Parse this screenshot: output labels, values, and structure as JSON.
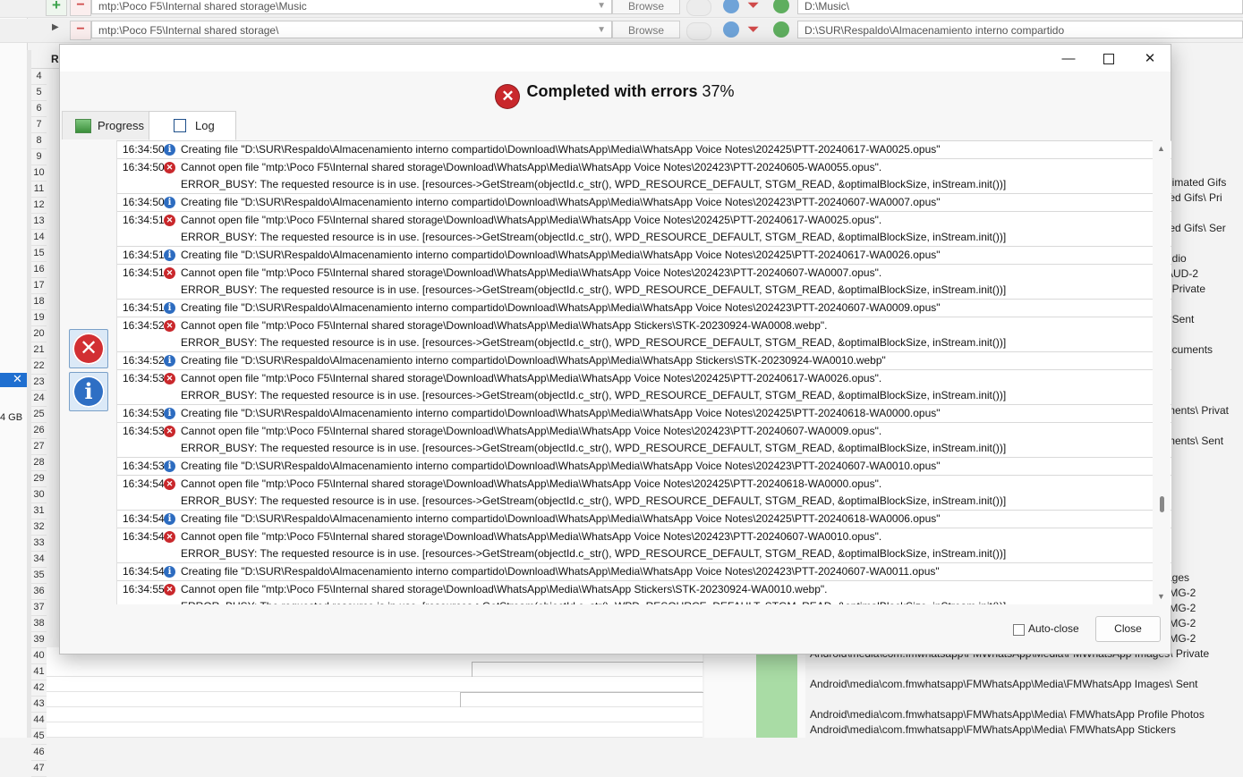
{
  "background": {
    "row1": {
      "path": "mtp:\\Poco F5\\Internal shared storage\\Music",
      "browse": "Browse",
      "dest": "D:\\Music\\"
    },
    "row2": {
      "path": "mtp:\\Poco F5\\Internal shared storage\\",
      "browse": "Browse",
      "dest": "D:\\SUR\\Respaldo\\Almacenamiento interno compartido"
    },
    "column_header": "R",
    "left_size": "4 GB",
    "row_numbers": [
      "4",
      "5",
      "6",
      "7",
      "8",
      "9",
      "10",
      "11",
      "12",
      "13",
      "14",
      "15",
      "16",
      "17",
      "18",
      "19",
      "20",
      "21",
      "22",
      "23",
      "24",
      "25",
      "26",
      "27",
      "28",
      "29",
      "30",
      "31",
      "32",
      "33",
      "34",
      "35",
      "36",
      "37",
      "38",
      "39",
      "40",
      "41",
      "42",
      "43",
      "44",
      "45",
      "46",
      "47"
    ],
    "right_items": [
      {
        "row": 11,
        "text": "nimated Gifs"
      },
      {
        "row": 12,
        "text": "ted Gifs\\ Pri"
      },
      {
        "row": 14,
        "text": "ted Gifs\\ Ser"
      },
      {
        "row": 16,
        "text": "udio"
      },
      {
        "row": 17,
        "text": "AUD-2"
      },
      {
        "row": 18,
        "text": "\\ Private"
      },
      {
        "row": 20,
        "text": "\\ Sent"
      },
      {
        "row": 22,
        "text": "ocuments"
      },
      {
        "row": 26,
        "text": "ments\\ Privat"
      },
      {
        "row": 28,
        "text": "ments\\ Sent"
      },
      {
        "row": 37,
        "text": "ages"
      },
      {
        "row": 38,
        "text": "IMG-2"
      },
      {
        "row": 39,
        "text": "IMG-2"
      },
      {
        "row": 40,
        "text": "IMG-2"
      },
      {
        "row": 41,
        "text": "IMG-2"
      }
    ],
    "bottom_paths": [
      {
        "row": 42,
        "text": "Android\\media\\com.fmwhatsapp\\FMWhatsApp\\Media\\FMWhatsApp Images\\ Private"
      },
      {
        "row": 44,
        "text": "Android\\media\\com.fmwhatsapp\\FMWhatsApp\\Media\\FMWhatsApp Images\\ Sent"
      },
      {
        "row": 46,
        "text": "Android\\media\\com.fmwhatsapp\\FMWhatsApp\\Media\\ FMWhatsApp Profile Photos"
      },
      {
        "row": 47,
        "text": "Android\\media\\com.fmwhatsapp\\FMWhatsApp\\Media\\ FMWhatsApp Stickers"
      }
    ]
  },
  "dialog": {
    "status": "Completed with errors",
    "percent": "37%",
    "tabs": {
      "progress": "Progress",
      "log": "Log"
    },
    "auto_close": "Auto-close",
    "close": "Close",
    "log": [
      {
        "type": "info",
        "time": "16:34:50",
        "msg": "Creating file \"D:\\SUR\\Respaldo\\Almacenamiento interno compartido\\Download\\WhatsApp\\Media\\WhatsApp Voice Notes\\202425\\PTT-20240617-WA0025.opus\""
      },
      {
        "type": "error",
        "time": "16:34:50",
        "msg": "Cannot open file \"mtp:\\Poco F5\\Internal shared storage\\Download\\WhatsApp\\Media\\WhatsApp Voice Notes\\202423\\PTT-20240605-WA0055.opus\".",
        "detail": "ERROR_BUSY: The requested resource is in use. [resources->GetStream(objectId.c_str(), WPD_RESOURCE_DEFAULT, STGM_READ, &optimalBlockSize, inStream.init())]"
      },
      {
        "type": "info",
        "time": "16:34:50",
        "msg": "Creating file \"D:\\SUR\\Respaldo\\Almacenamiento interno compartido\\Download\\WhatsApp\\Media\\WhatsApp Voice Notes\\202423\\PTT-20240607-WA0007.opus\""
      },
      {
        "type": "error",
        "time": "16:34:51",
        "msg": "Cannot open file \"mtp:\\Poco F5\\Internal shared storage\\Download\\WhatsApp\\Media\\WhatsApp Voice Notes\\202425\\PTT-20240617-WA0025.opus\".",
        "detail": "ERROR_BUSY: The requested resource is in use. [resources->GetStream(objectId.c_str(), WPD_RESOURCE_DEFAULT, STGM_READ, &optimalBlockSize, inStream.init())]"
      },
      {
        "type": "info",
        "time": "16:34:51",
        "msg": "Creating file \"D:\\SUR\\Respaldo\\Almacenamiento interno compartido\\Download\\WhatsApp\\Media\\WhatsApp Voice Notes\\202425\\PTT-20240617-WA0026.opus\""
      },
      {
        "type": "error",
        "time": "16:34:51",
        "msg": "Cannot open file \"mtp:\\Poco F5\\Internal shared storage\\Download\\WhatsApp\\Media\\WhatsApp Voice Notes\\202423\\PTT-20240607-WA0007.opus\".",
        "detail": "ERROR_BUSY: The requested resource is in use. [resources->GetStream(objectId.c_str(), WPD_RESOURCE_DEFAULT, STGM_READ, &optimalBlockSize, inStream.init())]"
      },
      {
        "type": "info",
        "time": "16:34:51",
        "msg": "Creating file \"D:\\SUR\\Respaldo\\Almacenamiento interno compartido\\Download\\WhatsApp\\Media\\WhatsApp Voice Notes\\202423\\PTT-20240607-WA0009.opus\""
      },
      {
        "type": "error",
        "time": "16:34:52",
        "msg": "Cannot open file \"mtp:\\Poco F5\\Internal shared storage\\Download\\WhatsApp\\Media\\WhatsApp Stickers\\STK-20230924-WA0008.webp\".",
        "detail": "ERROR_BUSY: The requested resource is in use. [resources->GetStream(objectId.c_str(), WPD_RESOURCE_DEFAULT, STGM_READ, &optimalBlockSize, inStream.init())]"
      },
      {
        "type": "info",
        "time": "16:34:52",
        "msg": "Creating file \"D:\\SUR\\Respaldo\\Almacenamiento interno compartido\\Download\\WhatsApp\\Media\\WhatsApp Stickers\\STK-20230924-WA0010.webp\""
      },
      {
        "type": "error",
        "time": "16:34:53",
        "msg": "Cannot open file \"mtp:\\Poco F5\\Internal shared storage\\Download\\WhatsApp\\Media\\WhatsApp Voice Notes\\202425\\PTT-20240617-WA0026.opus\".",
        "detail": "ERROR_BUSY: The requested resource is in use. [resources->GetStream(objectId.c_str(), WPD_RESOURCE_DEFAULT, STGM_READ, &optimalBlockSize, inStream.init())]"
      },
      {
        "type": "info",
        "time": "16:34:53",
        "msg": "Creating file \"D:\\SUR\\Respaldo\\Almacenamiento interno compartido\\Download\\WhatsApp\\Media\\WhatsApp Voice Notes\\202425\\PTT-20240618-WA0000.opus\""
      },
      {
        "type": "error",
        "time": "16:34:53",
        "msg": "Cannot open file \"mtp:\\Poco F5\\Internal shared storage\\Download\\WhatsApp\\Media\\WhatsApp Voice Notes\\202423\\PTT-20240607-WA0009.opus\".",
        "detail": "ERROR_BUSY: The requested resource is in use. [resources->GetStream(objectId.c_str(), WPD_RESOURCE_DEFAULT, STGM_READ, &optimalBlockSize, inStream.init())]"
      },
      {
        "type": "info",
        "time": "16:34:53",
        "msg": "Creating file \"D:\\SUR\\Respaldo\\Almacenamiento interno compartido\\Download\\WhatsApp\\Media\\WhatsApp Voice Notes\\202423\\PTT-20240607-WA0010.opus\""
      },
      {
        "type": "error",
        "time": "16:34:54",
        "msg": "Cannot open file \"mtp:\\Poco F5\\Internal shared storage\\Download\\WhatsApp\\Media\\WhatsApp Voice Notes\\202425\\PTT-20240618-WA0000.opus\".",
        "detail": "ERROR_BUSY: The requested resource is in use. [resources->GetStream(objectId.c_str(), WPD_RESOURCE_DEFAULT, STGM_READ, &optimalBlockSize, inStream.init())]"
      },
      {
        "type": "info",
        "time": "16:34:54",
        "msg": "Creating file \"D:\\SUR\\Respaldo\\Almacenamiento interno compartido\\Download\\WhatsApp\\Media\\WhatsApp Voice Notes\\202425\\PTT-20240618-WA0006.opus\""
      },
      {
        "type": "error",
        "time": "16:34:54",
        "msg": "Cannot open file \"mtp:\\Poco F5\\Internal shared storage\\Download\\WhatsApp\\Media\\WhatsApp Voice Notes\\202423\\PTT-20240607-WA0010.opus\".",
        "detail": "ERROR_BUSY: The requested resource is in use. [resources->GetStream(objectId.c_str(), WPD_RESOURCE_DEFAULT, STGM_READ, &optimalBlockSize, inStream.init())]"
      },
      {
        "type": "info",
        "time": "16:34:54",
        "msg": "Creating file \"D:\\SUR\\Respaldo\\Almacenamiento interno compartido\\Download\\WhatsApp\\Media\\WhatsApp Voice Notes\\202423\\PTT-20240607-WA0011.opus\""
      },
      {
        "type": "error",
        "time": "16:34:55",
        "msg": "Cannot open file \"mtp:\\Poco F5\\Internal shared storage\\Download\\WhatsApp\\Media\\WhatsApp Stickers\\STK-20230924-WA0010.webp\".",
        "detail": "ERROR_BUSY: The requested resource is in use. [resources->GetStream(objectId.c_str(), WPD_RESOURCE_DEFAULT, STGM_READ, &optimalBlockSize, inStream.init())]"
      }
    ],
    "colors": {
      "error": "#c9282c",
      "info": "#2d6cc0"
    },
    "icons": [
      "error-icon",
      "info-icon",
      "minimize-icon",
      "maximize-icon",
      "close-icon",
      "progress-tab-icon",
      "log-tab-icon"
    ]
  }
}
